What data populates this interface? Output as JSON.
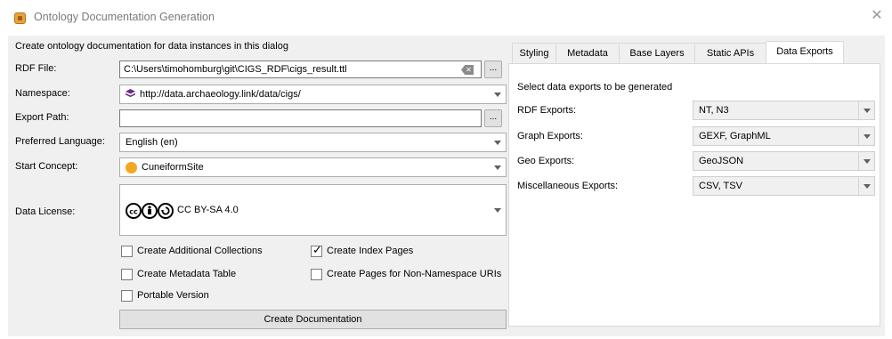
{
  "window": {
    "title": "Ontology Documentation Generation"
  },
  "left": {
    "description": "Create ontology documentation for data instances in this dialog",
    "rdf_file": {
      "label": "RDF File:",
      "value": "C:\\Users\\timohomburg\\git\\CIGS_RDF\\cigs_result.ttl",
      "browse": "..."
    },
    "namespace": {
      "label": "Namespace:",
      "value": "http://data.archaeology.link/data/cigs/"
    },
    "export_path": {
      "label": "Export Path:",
      "value": "",
      "browse": "..."
    },
    "preferred_language": {
      "label": "Preferred Language:",
      "value": "English (en)"
    },
    "start_concept": {
      "label": "Start Concept:",
      "value": "CuneiformSite"
    },
    "data_license": {
      "label": "Data License:",
      "value": "CC BY-SA 4.0"
    },
    "checkboxes": [
      {
        "label": "Create Additional Collections",
        "checked": false
      },
      {
        "label": "Create Index Pages",
        "checked": true
      },
      {
        "label": "Create Metadata Table",
        "checked": false
      },
      {
        "label": "Create Pages for Non-Namespace URIs",
        "checked": false
      },
      {
        "label": "Portable Version",
        "checked": false
      }
    ],
    "create_button": "Create Documentation"
  },
  "tabs": [
    {
      "label": "Styling",
      "active": false
    },
    {
      "label": "Metadata",
      "active": false
    },
    {
      "label": "Base Layers",
      "active": false
    },
    {
      "label": "Static APIs",
      "active": false
    },
    {
      "label": "Data Exports",
      "active": true
    }
  ],
  "exports": {
    "heading": "Select data exports to be generated",
    "rows": [
      {
        "label": "RDF Exports:",
        "value": "NT, N3"
      },
      {
        "label": "Graph Exports:",
        "value": "GEXF, GraphML"
      },
      {
        "label": "Geo Exports:",
        "value": "GeoJSON"
      },
      {
        "label": "Miscellaneous Exports:",
        "value": "CSV, TSV"
      }
    ]
  },
  "colors": {
    "client_bg": "#f0f0f0",
    "concept_icon": "#f5a623",
    "namespace_icon": "#6a2a8c"
  }
}
